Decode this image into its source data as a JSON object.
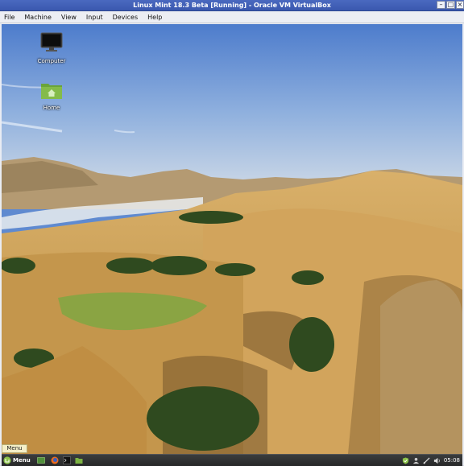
{
  "window": {
    "title": "Linux Mint 18.3 Beta [Running] - Oracle VM VirtualBox",
    "controls": [
      "minimize",
      "restore",
      "close"
    ]
  },
  "menubar": {
    "items": [
      "File",
      "Machine",
      "View",
      "Input",
      "Devices",
      "Help"
    ]
  },
  "desktop": {
    "icons": [
      {
        "label": "Computer",
        "icon": "monitor-icon"
      },
      {
        "label": "Home",
        "icon": "home-folder-icon"
      }
    ],
    "wallpaper": "mountain-valley-landscape"
  },
  "tooltip": {
    "text": "Menu"
  },
  "taskbar": {
    "menu_label": "Menu",
    "launchers": [
      "show-desktop-icon",
      "firefox-icon",
      "terminal-icon",
      "files-icon"
    ],
    "tray_icons": [
      "shield-icon",
      "user-icon",
      "network-icon",
      "volume-icon"
    ],
    "clock": "05:08"
  },
  "colors": {
    "titlebar": "#3f5fb7",
    "taskbar": "#2e3031",
    "mint_green": "#8cc34a"
  }
}
